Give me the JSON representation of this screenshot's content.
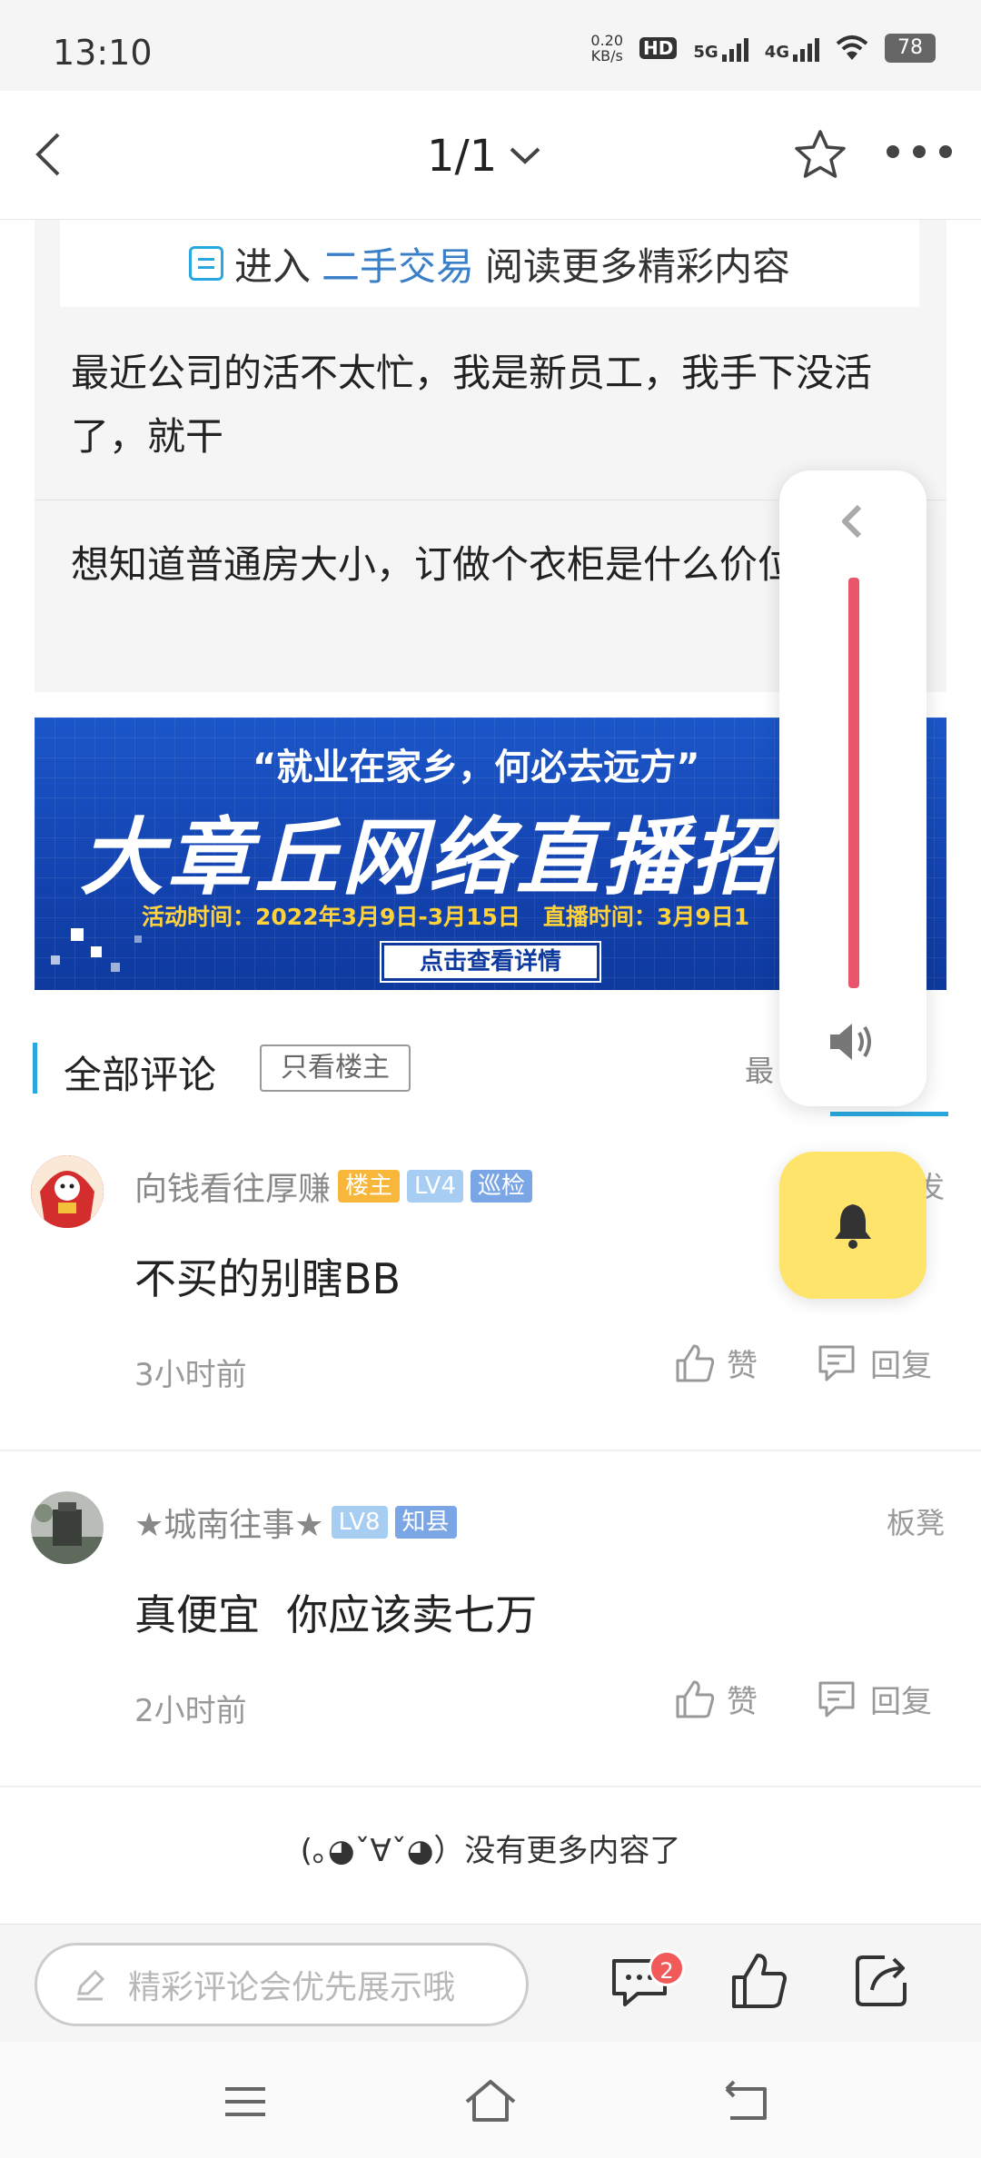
{
  "status_bar": {
    "time": "13:10",
    "net_speed_value": "0.20",
    "net_speed_unit": "KB/s",
    "hd_label": "HD",
    "signal_5g": "5G",
    "signal_4g": "4G",
    "battery": "78"
  },
  "nav": {
    "page_indicator": "1/1",
    "icons": [
      "back-arrow-icon",
      "chevron-down-icon",
      "star-icon",
      "more-dots-icon"
    ]
  },
  "post": {
    "enter_prefix": "进入",
    "enter_link": "二手交易",
    "enter_suffix": "阅读更多精彩内容",
    "para1": "最近公司的活不太忙，我是新员工，我手下没活了，就干",
    "para2": "想知道普通房大小，订做个衣柜是什么价位？"
  },
  "banner": {
    "quote": "“就业在家乡，何必去远方”",
    "title": "大章丘网络直播招聘",
    "info": "活动时间：2022年3月9日-3月15日　直播时间：3月9日1",
    "button": "点击查看详情"
  },
  "comments_header": {
    "title": "全部评论",
    "filter": "只看楼主",
    "sort": "最"
  },
  "comments": [
    {
      "name": "向钱看往厚赚",
      "badges": [
        "楼主",
        "LV4",
        "巡检"
      ],
      "floor": "沙发",
      "text": "不买的别瞎BB",
      "time": "3小时前",
      "like": "赞",
      "reply": "回复"
    },
    {
      "name": "★城南往事★",
      "badges": [
        "LV8",
        "知县"
      ],
      "floor": "板凳",
      "text": "真便宜  你应该卖七万",
      "time": "2小时前",
      "like": "赞",
      "reply": "回复"
    }
  ],
  "no_more": "(｡◕ˇ∀ˇ◕）没有更多内容了",
  "bottom_bar": {
    "placeholder": "精彩评论会优先展示哦",
    "comment_count": "2"
  },
  "colors": {
    "accent": "#29a8e0",
    "link": "#3a7fc7",
    "owner_badge": "#f8b73a",
    "level_badge": "#a7cdf2",
    "role_badge": "#7aa6e6",
    "notification": "#f25a5a",
    "side_bar": "#e9556b",
    "bell_fab": "#fee46a"
  }
}
